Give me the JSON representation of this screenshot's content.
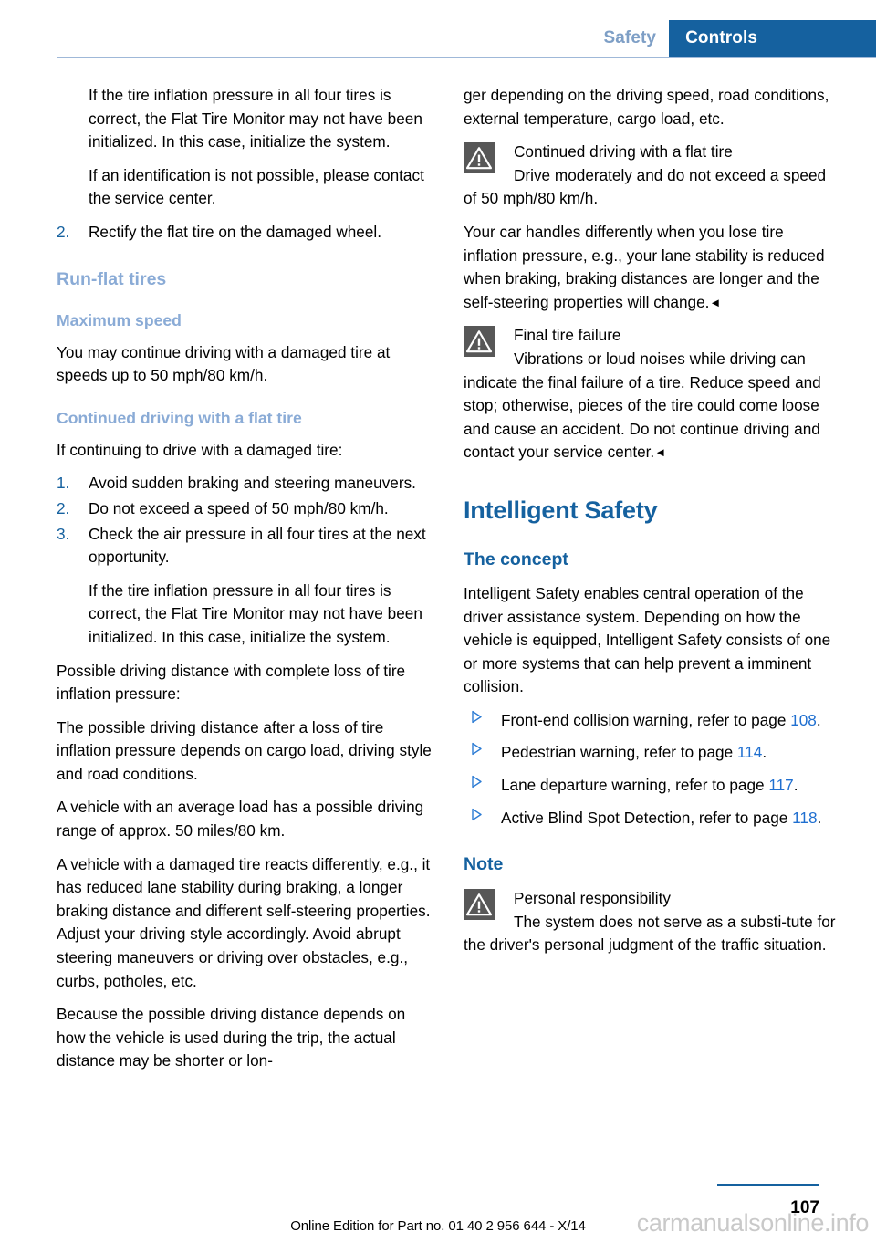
{
  "header": {
    "inactive_tab": "Safety",
    "active_tab": "Controls",
    "accent_blue": "#15619f",
    "muted_blue": "#7e9fc6"
  },
  "left_column": {
    "continuation_note_1": "If the tire inflation pressure in all four tires is correct, the Flat Tire Monitor may not have been initialized. In this case, initialize the system.",
    "continuation_note_2": "If an identification is not possible, please contact the service center.",
    "step_2_num": "2.",
    "step_2_text": "Rectify the flat tire on the damaged wheel.",
    "heading_runflat": "Run-flat tires",
    "heading_max_speed": "Maximum speed",
    "max_speed_text": "You may continue driving with a damaged tire at speeds up to 50 mph/80 km/h.",
    "heading_continued_driving": "Continued driving with a flat tire",
    "continued_intro": "If continuing to drive with a damaged tire:",
    "steps": [
      {
        "num": "1.",
        "text": "Avoid sudden braking and steering maneuvers."
      },
      {
        "num": "2.",
        "text": "Do not exceed a speed of 50 mph/80 km/h."
      },
      {
        "num": "3.",
        "text": "Check the air pressure in all four tires at the next opportunity."
      }
    ],
    "step_3_note": "If the tire inflation pressure in all four tires is correct, the Flat Tire Monitor may not have been initialized. In this case, initialize the system.",
    "possible_distance_label": "Possible driving distance with complete loss of tire inflation pressure:",
    "possible_distance_p1": "The possible driving distance after a loss of tire inflation pressure depends on cargo load, driving style and road conditions.",
    "possible_distance_p2": "A vehicle with an average load has a possible driving range of approx. 50 miles/80 km.",
    "reacts_differently": "A vehicle with a damaged tire reacts differently, e.g., it has reduced lane stability during braking, a longer braking distance and different self-steering properties. Adjust your driving style accordingly. Avoid abrupt steering maneuvers or driving over obstacles, e.g., curbs, potholes, etc.",
    "because_distance": "Because the possible driving distance depends on how the vehicle is used during the trip, the actual distance may be shorter or lon-"
  },
  "right_column": {
    "continuation_top": "ger depending on the driving speed, road conditions, external temperature, cargo load, etc.",
    "warning_1": {
      "icon": "warning-triangle-icon",
      "title": "Continued driving with a flat tire",
      "body_lead": "Drive moderately and do not exceed a",
      "body_rest": "speed of 50 mph/80 km/h."
    },
    "handles_differently": "Your car handles differently when you lose tire inflation pressure, e.g., your lane stability is reduced when braking, braking distances are longer and the self-steering properties will change.",
    "endmark": "◄",
    "warning_2": {
      "icon": "warning-triangle-icon",
      "title": "Final tire failure",
      "body_lead": "Vibrations or loud noises while driving",
      "body_rest": "can indicate the final failure of a tire. Reduce speed and stop; otherwise, pieces of the tire could come loose and cause an accident. Do not continue driving and contact your service center."
    },
    "heading_intelligent_safety": "Intelligent Safety",
    "heading_the_concept": "The concept",
    "concept_text": "Intelligent Safety enables central operation of the driver assistance system. Depending on how the vehicle is equipped, Intelligent Safety consists of one or more systems that can help prevent a imminent collision.",
    "systems": [
      {
        "bullet": "triangle-bullet-icon",
        "text_before": "Front-end collision warning, refer to page ",
        "page": "108",
        "text_after": "."
      },
      {
        "bullet": "triangle-bullet-icon",
        "text_before": "Pedestrian warning, refer to page ",
        "page": "114",
        "text_after": "."
      },
      {
        "bullet": "triangle-bullet-icon",
        "text_before": "Lane departure warning, refer to page ",
        "page": "117",
        "text_after": "."
      },
      {
        "bullet": "triangle-bullet-icon",
        "text_before": "Active Blind Spot Detection, refer to page ",
        "page": "118",
        "text_after": "."
      }
    ],
    "heading_note": "Note",
    "warning_3": {
      "icon": "warning-triangle-icon",
      "title": "Personal responsibility",
      "body_lead": "The system does not serve as a substi-",
      "body_rest": "tute for the driver's personal judgment of the traffic situation."
    }
  },
  "footer": {
    "edition_line": "Online Edition for Part no. 01 40 2 956 644 - X/14",
    "page_number": "107",
    "watermark": "carmanualsonline.info"
  }
}
